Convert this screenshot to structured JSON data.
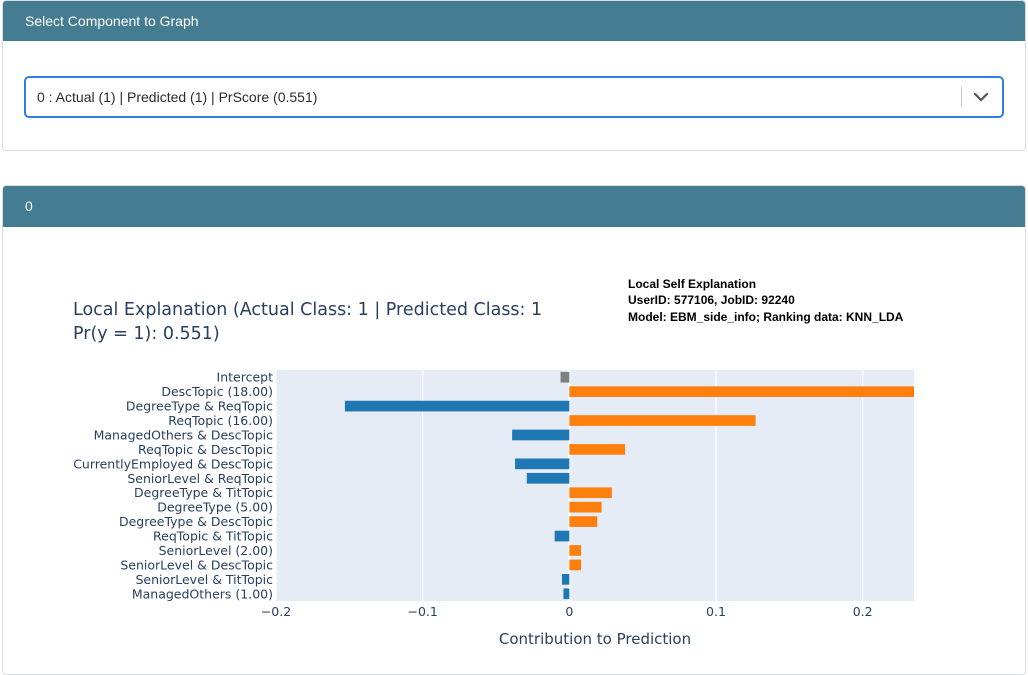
{
  "selector_card": {
    "header": "Select Component to Graph",
    "selected_value": "0 : Actual (1) | Predicted (1) | PrScore (0.551)"
  },
  "graph_card": {
    "header": "0"
  },
  "chart_data": {
    "type": "bar",
    "orientation": "horizontal",
    "title_lines": [
      "Local Explanation (Actual Class: 1 | Predicted Class: 1",
      "Pr(y = 1): 0.551)"
    ],
    "annotation_lines": [
      "Local Self Explanation",
      "UserID: 577106, JobID: 92240",
      "Model: EBM_side_info; Ranking data: KNN_LDA"
    ],
    "xlabel": "Contribution to Prediction",
    "ylabel": "",
    "xlim": [
      -0.2,
      0.235
    ],
    "x_ticks": [
      -0.2,
      -0.1,
      0,
      0.1,
      0.2
    ],
    "x_tick_labels": [
      "−0.2",
      "−0.1",
      "0",
      "0.1",
      "0.2"
    ],
    "grid": true,
    "categories": [
      "Intercept",
      "DescTopic (18.00)",
      "DegreeType & ReqTopic",
      "ReqTopic (16.00)",
      "ManagedOthers & DescTopic",
      "ReqTopic & DescTopic",
      "CurrentlyEmployed & DescTopic",
      "SeniorLevel & ReqTopic",
      "DegreeType & TitTopic",
      "DegreeType (5.00)",
      "DegreeType & DescTopic",
      "ReqTopic & TitTopic",
      "SeniorLevel (2.00)",
      "SeniorLevel & DescTopic",
      "SeniorLevel & TitTopic",
      "ManagedOthers (1.00)"
    ],
    "values": [
      -0.006,
      0.235,
      -0.153,
      0.127,
      -0.039,
      0.038,
      -0.037,
      -0.029,
      0.029,
      0.022,
      0.019,
      -0.01,
      0.008,
      0.008,
      -0.005,
      -0.004
    ],
    "colors": {
      "positive": "#ff7f0e",
      "negative": "#1f77b4",
      "intercept": "#7f7f7f",
      "plot_bg": "#e5ecf6",
      "header_bg": "#447c92"
    }
  }
}
